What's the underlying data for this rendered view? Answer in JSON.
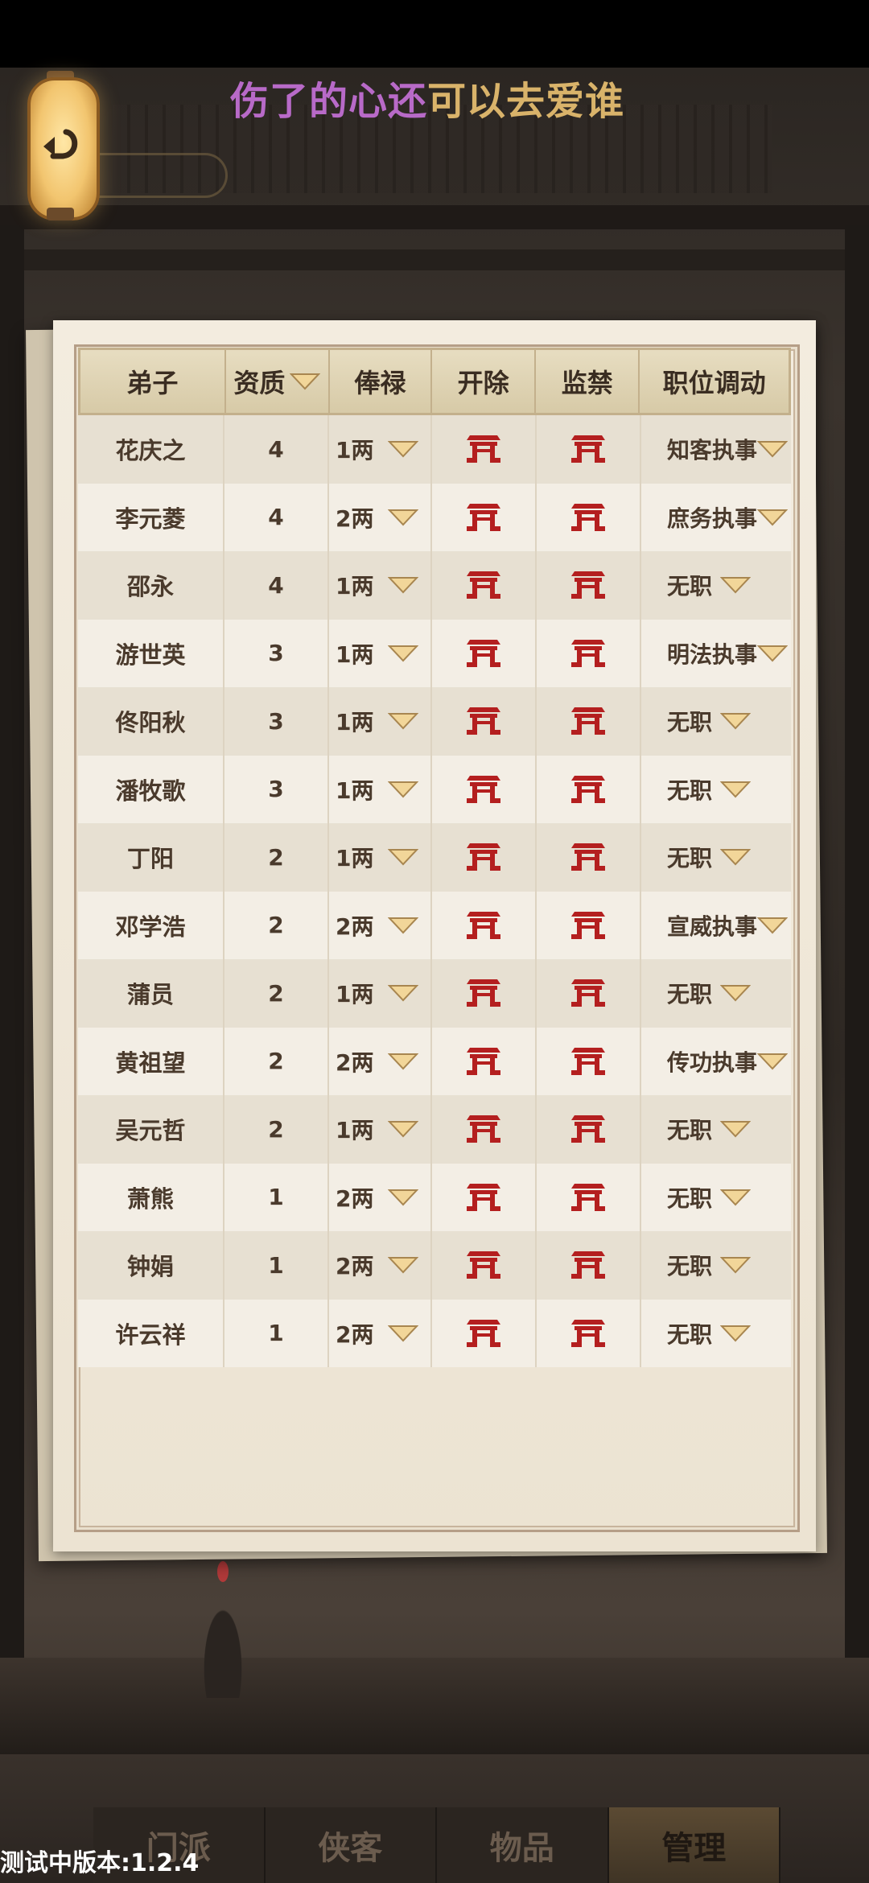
{
  "marquee": {
    "part_a": "伤了的心还",
    "part_b": "可以去爱谁"
  },
  "back_button": {
    "icon": "back-arrow-icon"
  },
  "table": {
    "headers": {
      "disciple": "弟子",
      "aptitude": "资质",
      "salary": "俸禄",
      "dismiss": "开除",
      "imprison": "监禁",
      "position": "职位调动"
    },
    "rows": [
      {
        "name": "花庆之",
        "aptitude": "4",
        "salary": "1两",
        "position": "知客执事"
      },
      {
        "name": "李元菱",
        "aptitude": "4",
        "salary": "2两",
        "position": "庶务执事"
      },
      {
        "name": "邵永",
        "aptitude": "4",
        "salary": "1两",
        "position": "无职"
      },
      {
        "name": "游世英",
        "aptitude": "3",
        "salary": "1两",
        "position": "明法执事"
      },
      {
        "name": "佟阳秋",
        "aptitude": "3",
        "salary": "1两",
        "position": "无职"
      },
      {
        "name": "潘牧歌",
        "aptitude": "3",
        "salary": "1两",
        "position": "无职"
      },
      {
        "name": "丁阳",
        "aptitude": "2",
        "salary": "1两",
        "position": "无职"
      },
      {
        "name": "邓学浩",
        "aptitude": "2",
        "salary": "2两",
        "position": "宣威执事"
      },
      {
        "name": "蒲员",
        "aptitude": "2",
        "salary": "1两",
        "position": "无职"
      },
      {
        "name": "黄祖望",
        "aptitude": "2",
        "salary": "2两",
        "position": "传功执事"
      },
      {
        "name": "吴元哲",
        "aptitude": "2",
        "salary": "1两",
        "position": "无职"
      },
      {
        "name": "萧熊",
        "aptitude": "1",
        "salary": "2两",
        "position": "无职"
      },
      {
        "name": "钟娟",
        "aptitude": "1",
        "salary": "2两",
        "position": "无职"
      },
      {
        "name": "许云祥",
        "aptitude": "1",
        "salary": "2两",
        "position": "无职"
      }
    ]
  },
  "nav": {
    "tabs": [
      "门派",
      "侠客",
      "物品",
      "管理"
    ],
    "active": "管理"
  },
  "version": "测试中版本:1.2.4",
  "colors": {
    "gate": "#b41f1f",
    "dropdown": "#f2d699",
    "marquee_a": "#b86ac8",
    "marquee_b": "#d9b36a"
  }
}
